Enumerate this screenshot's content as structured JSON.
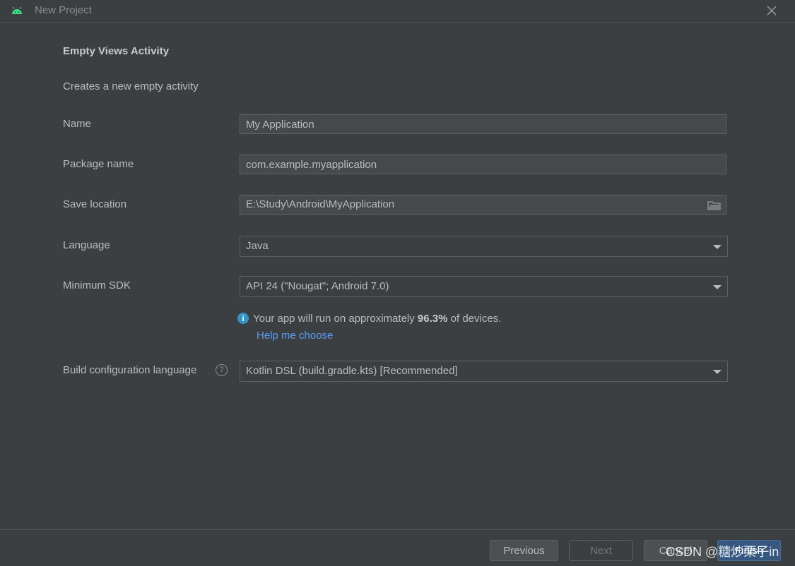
{
  "window": {
    "title": "New Project"
  },
  "form": {
    "heading": "Empty Views Activity",
    "description": "Creates a new empty activity",
    "name": {
      "label": "Name",
      "value": "My Application"
    },
    "package": {
      "label": "Package name",
      "value": "com.example.myapplication"
    },
    "location": {
      "label": "Save location",
      "value": "E:\\Study\\Android\\MyApplication"
    },
    "language": {
      "label": "Language",
      "value": "Java"
    },
    "min_sdk": {
      "label": "Minimum SDK",
      "value": "API 24 (\"Nougat\"; Android 7.0)"
    },
    "info": {
      "prefix": "Your app will run on approximately ",
      "percent": "96.3%",
      "suffix": " of devices.",
      "link": "Help me choose"
    },
    "build_lang": {
      "label": "Build configuration language",
      "value": "Kotlin DSL (build.gradle.kts) [Recommended]"
    }
  },
  "footer": {
    "previous": "Previous",
    "next": "Next",
    "cancel": "Cancel",
    "finish": "Finish",
    "watermark": "CSDN @糖炒栗子in"
  },
  "colors": {
    "background": "#3c3f41",
    "link": "#589df6",
    "info": "#3592c4",
    "android_green": "#3ddc84",
    "primary_button": "#365880"
  }
}
